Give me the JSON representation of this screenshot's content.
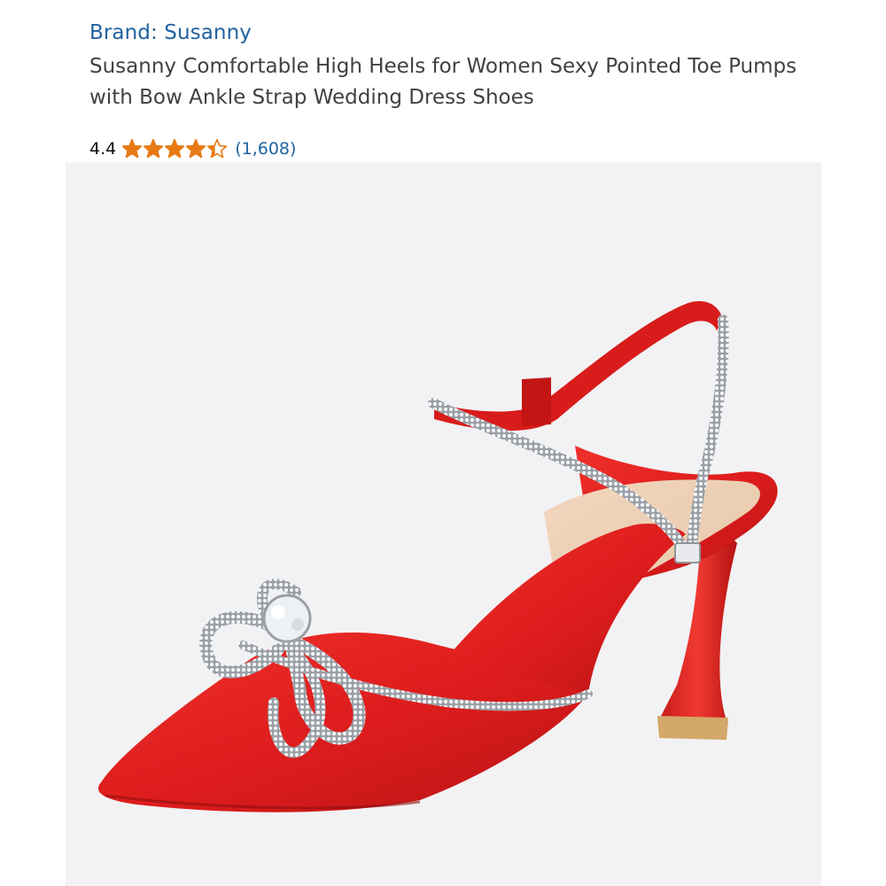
{
  "product": {
    "brand_label": "Brand: Susanny",
    "title": "Susanny Comfortable High Heels for Women Sexy Pointed Toe Pumps with Bow Ankle Strap Wedding Dress Shoes",
    "rating": {
      "value": "4.4",
      "stars": 4.4,
      "max_stars": 5,
      "review_count": "(1,608)"
    }
  },
  "colors": {
    "link": "#2162a1",
    "title_text": "#404141",
    "star": "#e87a14",
    "image_background": "#f2f2f4",
    "shoe_red": "#e0201f"
  },
  "image": {
    "subject": "red satin pointed-toe slingback pump with crystal bow",
    "icon": "product-photo"
  }
}
